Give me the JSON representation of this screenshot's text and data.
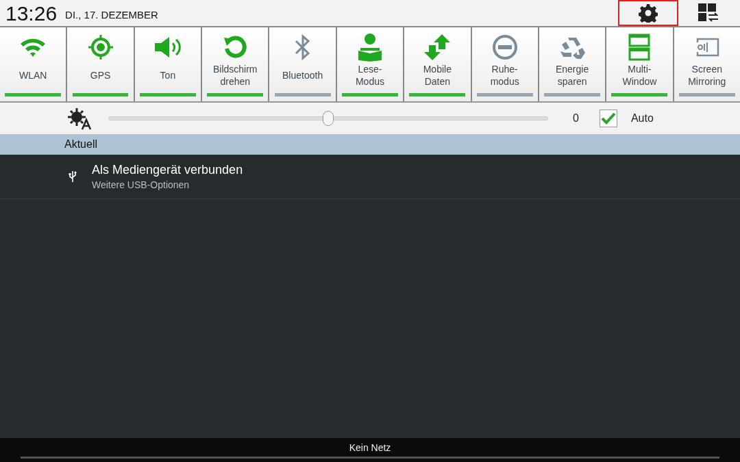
{
  "status": {
    "time": "13:26",
    "date": "DI., 17. DEZEMBER",
    "settings_highlighted": true
  },
  "toggles": [
    {
      "kind": "wifi",
      "label": [
        "WLAN"
      ],
      "on": true
    },
    {
      "kind": "gps",
      "label": [
        "GPS"
      ],
      "on": true
    },
    {
      "kind": "sound",
      "label": [
        "Ton"
      ],
      "on": true
    },
    {
      "kind": "rotate",
      "label": [
        "Bildschirm",
        "drehen"
      ],
      "on": true
    },
    {
      "kind": "bluetooth",
      "label": [
        "Bluetooth"
      ],
      "on": false
    },
    {
      "kind": "reader",
      "label": [
        "Lese-",
        "Modus"
      ],
      "on": true
    },
    {
      "kind": "data",
      "label": [
        "Mobile",
        "Daten"
      ],
      "on": true
    },
    {
      "kind": "block",
      "label": [
        "Ruhe-",
        "modus"
      ],
      "on": false
    },
    {
      "kind": "recycle",
      "label": [
        "Energie",
        "sparen"
      ],
      "on": false
    },
    {
      "kind": "multiwindow",
      "label": [
        "Multi-",
        "Window"
      ],
      "on": true
    },
    {
      "kind": "mirror",
      "label": [
        "Screen",
        "Mirroring"
      ],
      "on": false
    }
  ],
  "brightness": {
    "level": 0.5,
    "reading": "0",
    "auto": {
      "label": "Auto",
      "checked": true
    }
  },
  "section": {
    "title": "Aktuell"
  },
  "notifications": [
    {
      "title": "Als Mediengerät verbunden",
      "subtitle": "Weitere USB-Optionen"
    }
  ],
  "footer": {
    "carrier": "Kein Netz"
  }
}
